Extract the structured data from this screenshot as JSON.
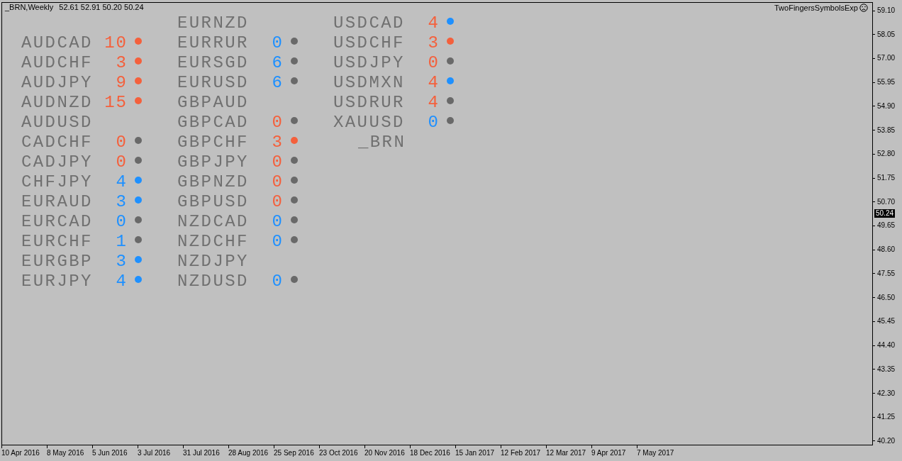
{
  "chart": {
    "title": "_BRN,Weekly",
    "ohlc": "52.61 52.91 50.20 50.24",
    "indicator": "TwoFingersSymbolsExp"
  },
  "columns": [
    {
      "items": [
        {
          "kind": "symbol",
          "name": "AUDCAD",
          "count": "10",
          "negative": true,
          "color": "#f4603c"
        },
        {
          "kind": "symbol",
          "name": "AUDCHF",
          "count": "3",
          "negative": true,
          "color": "#f4603c"
        },
        {
          "kind": "symbol",
          "name": "AUDJPY",
          "count": "9",
          "negative": true,
          "color": "#f4603c"
        },
        {
          "kind": "symbol",
          "name": "AUDNZD",
          "count": "15",
          "negative": true,
          "color": "#f4603c"
        },
        {
          "kind": "symbol",
          "name": "AUDUSD"
        },
        {
          "kind": "symbol",
          "name": "CADCHF",
          "count": "0",
          "negative": true,
          "color": "#696969"
        },
        {
          "kind": "symbol",
          "name": "CADJPY",
          "count": "0",
          "negative": true,
          "color": "#696969"
        },
        {
          "kind": "symbol",
          "name": "CHFJPY",
          "count": "4",
          "negative": false,
          "color": "#1e90ff"
        },
        {
          "kind": "symbol",
          "name": "EURAUD",
          "count": "3",
          "negative": false,
          "color": "#1e90ff"
        },
        {
          "kind": "symbol",
          "name": "EURCAD",
          "count": "0",
          "negative": false,
          "color": "#696969"
        },
        {
          "kind": "symbol",
          "name": "EURCHF",
          "count": "1",
          "negative": false,
          "color": "#696969"
        },
        {
          "kind": "symbol",
          "name": "EURGBP",
          "count": "3",
          "negative": false,
          "color": "#1e90ff"
        },
        {
          "kind": "symbol",
          "name": "EURJPY",
          "count": "4",
          "negative": false,
          "color": "#1e90ff"
        }
      ]
    },
    {
      "items": [
        {
          "kind": "symbol",
          "name": "EURNZD"
        },
        {
          "kind": "symbol",
          "name": "EURRUR",
          "count": "0",
          "negative": false,
          "color": "#696969"
        },
        {
          "kind": "symbol",
          "name": "EURSGD",
          "count": "6",
          "negative": false,
          "color": "#696969"
        },
        {
          "kind": "symbol",
          "name": "EURUSD",
          "count": "6",
          "negative": false,
          "color": "#696969"
        },
        {
          "kind": "symbol",
          "name": "GBPAUD"
        },
        {
          "kind": "symbol",
          "name": "GBPCAD",
          "count": "0",
          "negative": true,
          "color": "#696969"
        },
        {
          "kind": "symbol",
          "name": "GBPCHF",
          "count": "3",
          "negative": true,
          "color": "#f4603c"
        },
        {
          "kind": "symbol",
          "name": "GBPJPY",
          "count": "0",
          "negative": true,
          "color": "#696969"
        },
        {
          "kind": "symbol",
          "name": "GBPNZD",
          "count": "0",
          "negative": true,
          "color": "#696969"
        },
        {
          "kind": "symbol",
          "name": "GBPUSD",
          "count": "0",
          "negative": true,
          "color": "#696969"
        },
        {
          "kind": "symbol",
          "name": "NZDCAD",
          "count": "0",
          "negative": false,
          "color": "#696969"
        },
        {
          "kind": "symbol",
          "name": "NZDCHF",
          "count": "0",
          "negative": false,
          "color": "#696969"
        },
        {
          "kind": "symbol",
          "name": "NZDJPY"
        },
        {
          "kind": "symbol",
          "name": "NZDUSD",
          "count": "0",
          "negative": false,
          "color": "#696969"
        }
      ]
    },
    {
      "items": [
        {
          "kind": "symbol",
          "name": "USDCAD",
          "count": "4",
          "negative": true,
          "color": "#1e90ff"
        },
        {
          "kind": "symbol",
          "name": "USDCHF",
          "count": "3",
          "negative": true,
          "color": "#f4603c"
        },
        {
          "kind": "symbol",
          "name": "USDJPY",
          "count": "0",
          "negative": true,
          "color": "#696969"
        },
        {
          "kind": "symbol",
          "name": "USDMXN",
          "count": "4",
          "negative": true,
          "color": "#1e90ff"
        },
        {
          "kind": "symbol",
          "name": "USDRUR",
          "count": "4",
          "negative": true,
          "color": "#696969"
        },
        {
          "kind": "symbol",
          "name": "XAUUSD",
          "count": "0",
          "negative": false,
          "color": "#696969"
        },
        {
          "kind": "current",
          "name": "_BRN"
        }
      ]
    }
  ],
  "price_axis": {
    "labels": [
      "59.10",
      "58.05",
      "57.00",
      "55.95",
      "54.90",
      "53.85",
      "52.80",
      "51.75",
      "50.70",
      "49.65",
      "48.60",
      "47.55",
      "46.50",
      "45.45",
      "44.40",
      "43.35",
      "42.30",
      "41.25",
      "40.20"
    ],
    "current_price": "50.24"
  },
  "time_axis": {
    "labels": [
      "10 Apr 2016",
      "8 May 2016",
      "5 Jun 2016",
      "3 Jul 2016",
      "31 Jul 2016",
      "28 Aug 2016",
      "25 Sep 2016",
      "23 Oct 2016",
      "20 Nov 2016",
      "18 Dec 2016",
      "15 Jan 2017",
      "12 Feb 2017",
      "12 Mar 2017",
      "9 Apr 2017",
      "7 May 2017"
    ]
  }
}
